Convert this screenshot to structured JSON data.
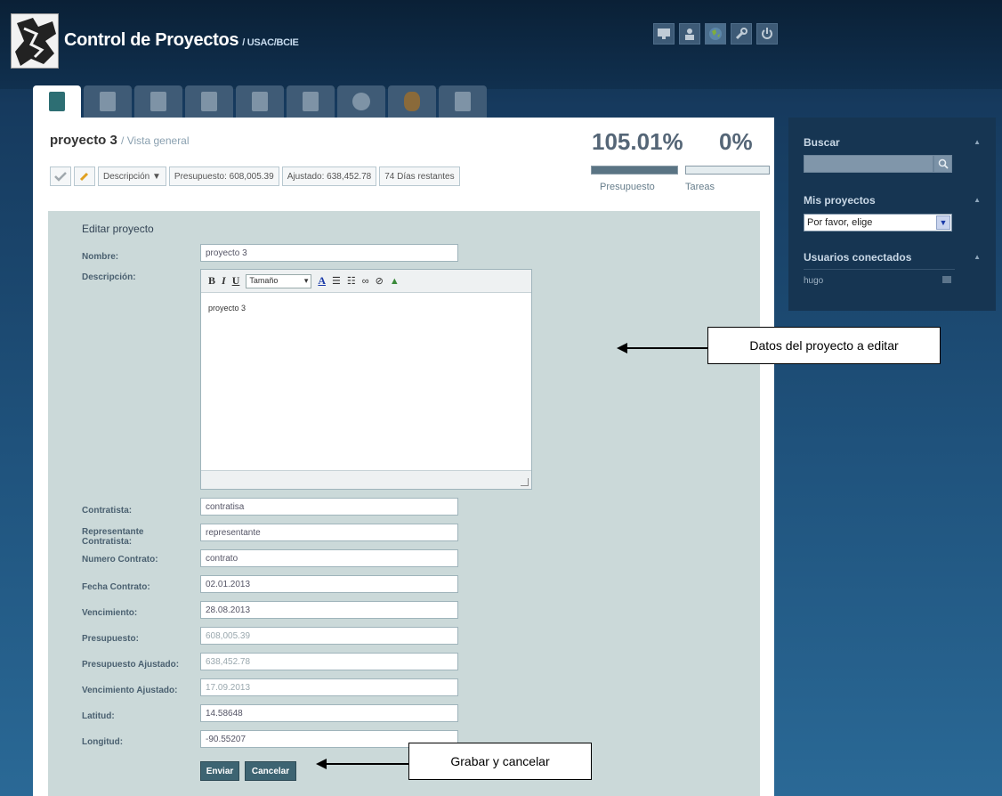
{
  "header": {
    "title": "Control de Proyectos",
    "subtitle": "/ USAC/BCIE"
  },
  "top_icons": [
    "monitor-icon",
    "user-icon",
    "globe-icon",
    "wrench-icon",
    "power-icon"
  ],
  "tabs": [
    "overview-tab",
    "calendar-tab",
    "list-tab",
    "edit-tab",
    "files-tab",
    "contacts-tab",
    "clock-tab",
    "money-tab",
    "clipboard-tab"
  ],
  "project": {
    "name": "proyecto 3",
    "view": "/ Vista general",
    "desc_button": "Descripción ▼",
    "budget": "Presupuesto: 608,005.39",
    "adjusted": "Ajustado: 638,452.78",
    "days_left": "74 Días restantes"
  },
  "stats": {
    "budget_pct": "105.01%",
    "tasks_pct": "0%",
    "budget_label": "Presupuesto",
    "tasks_label": "Tareas",
    "budget_fill": 1.0,
    "tasks_fill": 0.0
  },
  "form": {
    "title": "Editar proyecto",
    "labels": {
      "nombre": "Nombre:",
      "descripcion": "Descripción:",
      "contratista": "Contratista:",
      "representante": "Representante Contratista:",
      "numero": "Numero Contrato:",
      "fecha": "Fecha Contrato:",
      "vencimiento": "Vencimiento:",
      "presupuesto": "Presupuesto:",
      "presupuesto_aj": "Presupuesto Ajustado:",
      "vencimiento_aj": "Vencimiento Ajustado:",
      "latitud": "Latitud:",
      "longitud": "Longitud:"
    },
    "values": {
      "nombre": "proyecto 3",
      "descripcion": "proyecto 3",
      "contratista": "contratisa",
      "representante": "representante",
      "numero": "contrato",
      "fecha": "02.01.2013",
      "vencimiento": "28.08.2013",
      "presupuesto": "608,005.39",
      "presupuesto_aj": "638,452.78",
      "vencimiento_aj": "17.09.2013",
      "latitud": "14.58648",
      "longitud": "-90.55207"
    },
    "editor": {
      "bold": "B",
      "italic": "I",
      "underline": "U",
      "size": "Tamaño",
      "font_color": "A"
    },
    "submit": "Enviar",
    "cancel": "Cancelar"
  },
  "sidebar": {
    "search_title": "Buscar",
    "projects_title": "Mis proyectos",
    "projects_select": "Por favor, elige",
    "users_title": "Usuarios conectados",
    "user": "hugo"
  },
  "callouts": {
    "data": "Datos del proyecto a editar",
    "save": "Grabar y cancelar"
  }
}
